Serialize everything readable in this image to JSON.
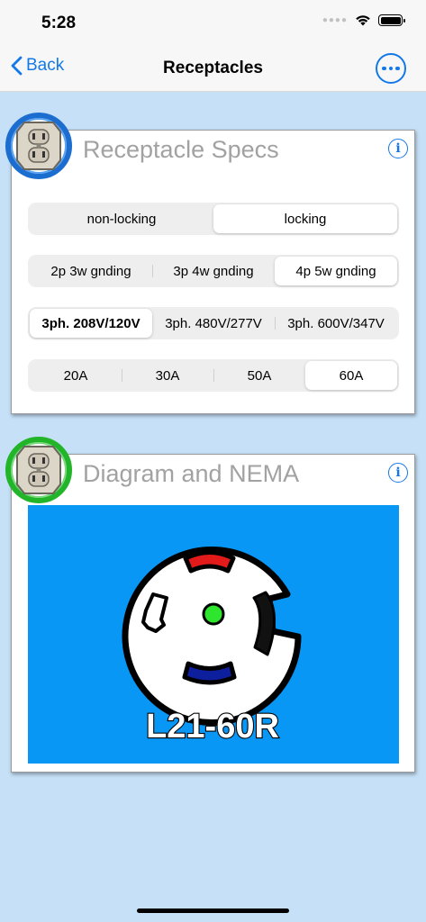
{
  "status": {
    "time": "5:28"
  },
  "nav": {
    "back_label": "Back",
    "title": "Receptacles"
  },
  "specs_card": {
    "title": "Receptacle Specs",
    "info": "i",
    "lock_options": [
      {
        "label": "non-locking",
        "selected": false
      },
      {
        "label": "locking",
        "selected": true
      }
    ],
    "wire_options": [
      {
        "label": "2p 3w gnding",
        "selected": false
      },
      {
        "label": "3p 4w gnding",
        "selected": false
      },
      {
        "label": "4p 5w gnding",
        "selected": true
      }
    ],
    "voltage_options": [
      {
        "label": "3ph. 208V/120V",
        "selected": true
      },
      {
        "label": "3ph. 480V/277V",
        "selected": false
      },
      {
        "label": "3ph. 600V/347V",
        "selected": false
      }
    ],
    "amp_options": [
      {
        "label": "20A",
        "selected": false
      },
      {
        "label": "30A",
        "selected": false
      },
      {
        "label": "50A",
        "selected": false
      },
      {
        "label": "60A",
        "selected": true
      }
    ]
  },
  "diagram_card": {
    "title": "Diagram and NEMA",
    "info": "i",
    "nema_code": "L21-60R"
  },
  "colors": {
    "accent": "#1479e8",
    "diagram_bg": "#0997f6",
    "hot_red": "#e21a1a",
    "neutral_blue": "#0e1f9e",
    "ground_green": "#2ee62e"
  }
}
